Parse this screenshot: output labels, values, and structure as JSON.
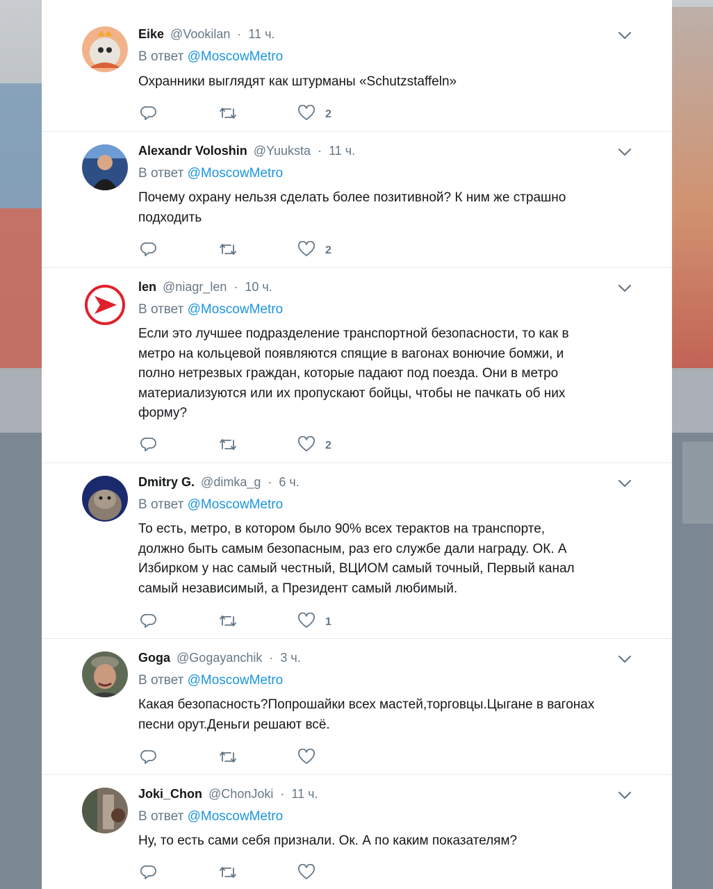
{
  "tweets": [
    {
      "name": "Eike",
      "handle": "@Vookilan",
      "sep": "·",
      "time": "11 ч.",
      "reply_prefix": "В ответ",
      "reply_to": "@MoscowMetro",
      "text": "Охранники выглядят как штурманы «Schutzstaffeln»",
      "likes": "2"
    },
    {
      "name": "Alexandr Voloshin",
      "handle": "@Yuuksta",
      "sep": "·",
      "time": "11 ч.",
      "reply_prefix": "В ответ",
      "reply_to": "@MoscowMetro",
      "text_lines": [
        "Почему охрану нельзя сделать более позитивной? К ним же страшно",
        "подходить"
      ],
      "likes": "2"
    },
    {
      "name": "len",
      "handle": "@niagr_len",
      "sep": "·",
      "time": "10 ч.",
      "reply_prefix": "В ответ",
      "reply_to": "@MoscowMetro",
      "text_lines": [
        "Если это лучшее подразделение транспортной безопасности, то как в",
        "метро на кольцевой появляются спящие в  вагонах вонючие бомжи, и",
        "полно нетрезвых граждан, которые падают под поезда. Они в метро",
        "материализуются или их пропускают бойцы, чтобы не пачкать об них",
        "форму?"
      ],
      "likes": "2"
    },
    {
      "name": "Dmitry G.",
      "handle": "@dimka_g",
      "sep": "·",
      "time": "6 ч.",
      "reply_prefix": "В ответ",
      "reply_to": "@MoscowMetro",
      "text_lines": [
        "То есть, метро, в котором было 90% всех терактов на транспорте,",
        "должно быть самым безопасным, раз его службе дали награду. ОК. А",
        "Избирком у нас самый честный, ВЦИОМ самый точный, Первый канал",
        "самый независимый, а Президент самый любимый."
      ],
      "likes": "1"
    },
    {
      "name": "Goga",
      "handle": "@Gogayanchik",
      "sep": "·",
      "time": "3 ч.",
      "reply_prefix": "В ответ",
      "reply_to": "@MoscowMetro",
      "text_lines": [
        "Какая безопасность?Попрошайки всех мастей,торговцы.Цыгане в вагонах",
        "песни орут.Деньги решают всё."
      ],
      "likes": ""
    },
    {
      "name": "Joki_Chon",
      "handle": "@ChonJoki",
      "sep": "·",
      "time": "11 ч.",
      "reply_prefix": "В ответ",
      "reply_to": "@MoscowMetro",
      "text": "Ну, то есть сами себя признали. Ок. А по каким показателям?",
      "likes": ""
    }
  ],
  "colors": {
    "link": "#1b95e0",
    "secondary": "#657786",
    "text": "#14171a"
  },
  "icons": [
    "reply-icon",
    "retweet-icon",
    "like-icon",
    "caret-down-icon"
  ]
}
